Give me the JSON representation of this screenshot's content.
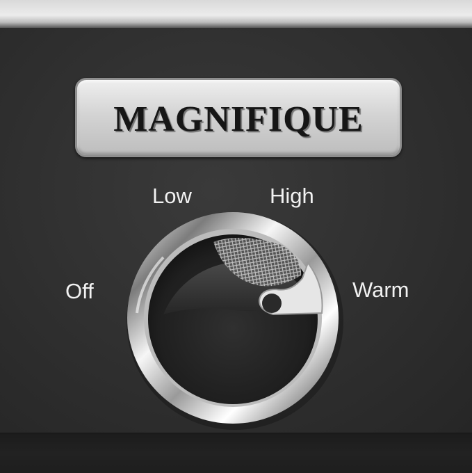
{
  "brand": {
    "name": "MAGNIFIQUE"
  },
  "dial": {
    "settings": {
      "low": "Low",
      "high": "High",
      "off": "Off",
      "warm": "Warm"
    }
  },
  "colors": {
    "panel": "#2b2b2b",
    "badge": "#d6d6d6",
    "label_text": "#f2f2f2",
    "chrome": "#e0e0e0"
  }
}
